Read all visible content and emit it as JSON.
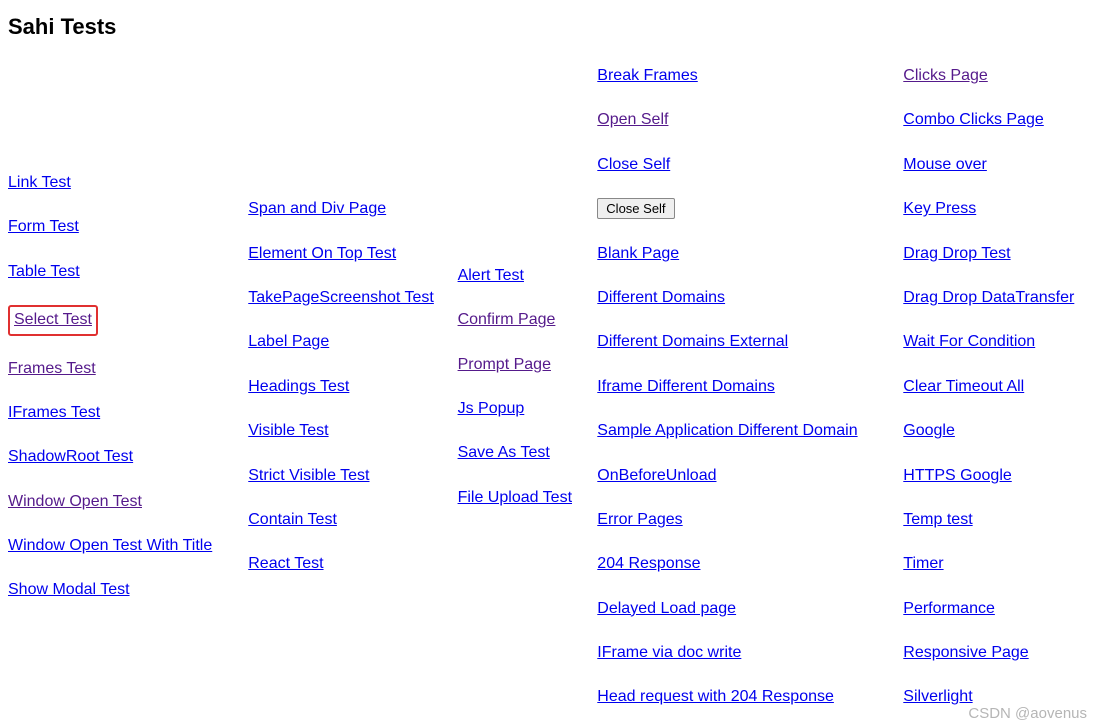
{
  "page_title": "Sahi Tests",
  "watermark": "CSDN @aovenus",
  "columns": {
    "col1": [
      {
        "label": "Link Test",
        "visited": false,
        "highlight": false
      },
      {
        "label": "Form Test",
        "visited": false,
        "highlight": false
      },
      {
        "label": "Table Test",
        "visited": false,
        "highlight": false
      },
      {
        "label": "Select Test",
        "visited": true,
        "highlight": true
      },
      {
        "label": "Frames Test",
        "visited": true,
        "highlight": false
      },
      {
        "label": "IFrames Test",
        "visited": false,
        "highlight": false
      },
      {
        "label": "ShadowRoot Test",
        "visited": false,
        "highlight": false
      },
      {
        "label": "Window Open Test",
        "visited": true,
        "highlight": false
      },
      {
        "label": "Window Open Test With Title",
        "visited": false,
        "highlight": false
      },
      {
        "label": "Show Modal Test",
        "visited": false,
        "highlight": false
      }
    ],
    "col2": [
      {
        "label": "Span and Div Page",
        "visited": false
      },
      {
        "label": "Element On Top Test",
        "visited": false
      },
      {
        "label": "TakePageScreenshot Test",
        "visited": false
      },
      {
        "label": "Label Page",
        "visited": false
      },
      {
        "label": "Headings Test",
        "visited": false
      },
      {
        "label": "Visible Test",
        "visited": false
      },
      {
        "label": "Strict Visible Test",
        "visited": false
      },
      {
        "label": "Contain Test",
        "visited": false
      },
      {
        "label": "React Test",
        "visited": false
      }
    ],
    "col3": [
      {
        "label": "Alert Test",
        "visited": false
      },
      {
        "label": "Confirm Page",
        "visited": true
      },
      {
        "label": "Prompt Page",
        "visited": true
      },
      {
        "label": "Js Popup",
        "visited": false
      },
      {
        "label": "Save As Test",
        "visited": false
      },
      {
        "label": "File Upload Test",
        "visited": false
      }
    ],
    "col4": [
      {
        "label": "Break Frames",
        "visited": false,
        "kind": "link"
      },
      {
        "label": "Open Self",
        "visited": true,
        "kind": "link"
      },
      {
        "label": "Close Self",
        "visited": false,
        "kind": "link"
      },
      {
        "label": "Close Self",
        "kind": "button"
      },
      {
        "label": "Blank Page",
        "visited": false,
        "kind": "link"
      },
      {
        "label": "Different Domains",
        "visited": false,
        "kind": "link"
      },
      {
        "label": "Different Domains External",
        "visited": false,
        "kind": "link"
      },
      {
        "label": "Iframe Different Domains",
        "visited": false,
        "kind": "link"
      },
      {
        "label": "Sample Application Different Domain",
        "visited": false,
        "kind": "link"
      },
      {
        "label": "OnBeforeUnload",
        "visited": false,
        "kind": "link"
      },
      {
        "label": "Error Pages",
        "visited": false,
        "kind": "link"
      },
      {
        "label": "204 Response",
        "visited": false,
        "kind": "link"
      },
      {
        "label": "Delayed Load page",
        "visited": false,
        "kind": "link"
      },
      {
        "label": "IFrame via doc write",
        "visited": false,
        "kind": "link"
      },
      {
        "label": "Head request with 204 Response",
        "visited": false,
        "kind": "link"
      }
    ],
    "col5": [
      {
        "label": "Clicks Page",
        "visited": true
      },
      {
        "label": "Combo Clicks Page",
        "visited": false
      },
      {
        "label": "Mouse over",
        "visited": false
      },
      {
        "label": "Key Press",
        "visited": false
      },
      {
        "label": "Drag Drop Test",
        "visited": false
      },
      {
        "label": "Drag Drop DataTransfer",
        "visited": false
      },
      {
        "label": "Wait For Condition",
        "visited": false
      },
      {
        "label": "Clear Timeout All",
        "visited": false
      },
      {
        "label": "Google",
        "visited": false
      },
      {
        "label": "HTTPS Google",
        "visited": false
      },
      {
        "label": "Temp test",
        "visited": false
      },
      {
        "label": "Timer",
        "visited": false
      },
      {
        "label": "Performance",
        "visited": false
      },
      {
        "label": "Responsive Page",
        "visited": false
      },
      {
        "label": "Silverlight",
        "visited": false
      }
    ]
  }
}
